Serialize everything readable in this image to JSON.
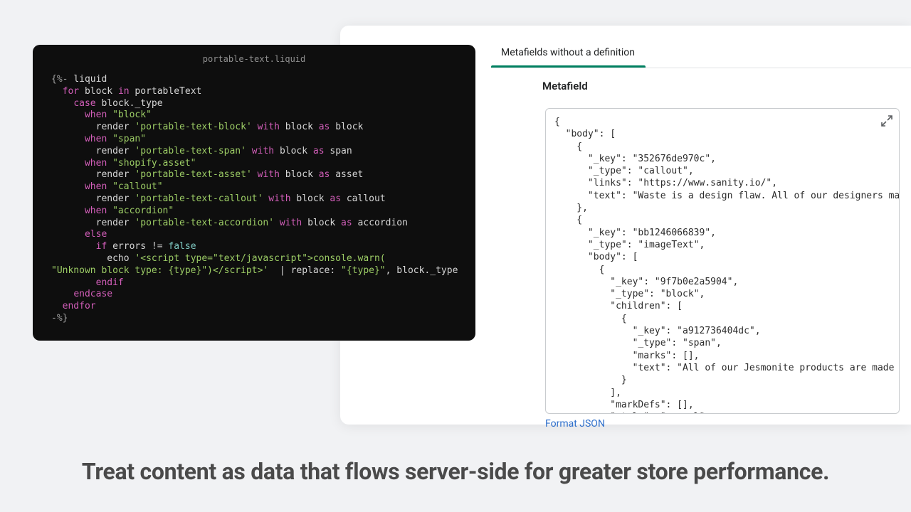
{
  "code_panel": {
    "filename": "portable-text.liquid",
    "tokens": [
      [
        [
          "punc",
          "{%- "
        ],
        [
          "ident",
          "liquid"
        ]
      ],
      [
        [
          "sp",
          "  "
        ],
        [
          "key",
          "for"
        ],
        [
          "sp",
          " "
        ],
        [
          "ident",
          "block"
        ],
        [
          "sp",
          " "
        ],
        [
          "key",
          "in"
        ],
        [
          "sp",
          " "
        ],
        [
          "ident",
          "portableText"
        ]
      ],
      [
        [
          "sp",
          "    "
        ],
        [
          "key",
          "case"
        ],
        [
          "sp",
          " "
        ],
        [
          "ident",
          "block._type"
        ]
      ],
      [
        [
          "sp",
          "      "
        ],
        [
          "key",
          "when"
        ],
        [
          "sp",
          " "
        ],
        [
          "str",
          "\"block\""
        ]
      ],
      [
        [
          "sp",
          "        "
        ],
        [
          "ident",
          "render"
        ],
        [
          "sp",
          " "
        ],
        [
          "str",
          "'portable-text-block'"
        ],
        [
          "sp",
          " "
        ],
        [
          "key",
          "with"
        ],
        [
          "sp",
          " "
        ],
        [
          "ident",
          "block"
        ],
        [
          "sp",
          " "
        ],
        [
          "key",
          "as"
        ],
        [
          "sp",
          " "
        ],
        [
          "ident",
          "block"
        ]
      ],
      [
        [
          "sp",
          "      "
        ],
        [
          "key",
          "when"
        ],
        [
          "sp",
          " "
        ],
        [
          "str",
          "\"span\""
        ]
      ],
      [
        [
          "sp",
          "        "
        ],
        [
          "ident",
          "render"
        ],
        [
          "sp",
          " "
        ],
        [
          "str",
          "'portable-text-span'"
        ],
        [
          "sp",
          " "
        ],
        [
          "key",
          "with"
        ],
        [
          "sp",
          " "
        ],
        [
          "ident",
          "block"
        ],
        [
          "sp",
          " "
        ],
        [
          "key",
          "as"
        ],
        [
          "sp",
          " "
        ],
        [
          "ident",
          "span"
        ]
      ],
      [
        [
          "sp",
          "      "
        ],
        [
          "key",
          "when"
        ],
        [
          "sp",
          " "
        ],
        [
          "str",
          "\"shopify.asset\""
        ]
      ],
      [
        [
          "sp",
          "        "
        ],
        [
          "ident",
          "render"
        ],
        [
          "sp",
          " "
        ],
        [
          "str",
          "'portable-text-asset'"
        ],
        [
          "sp",
          " "
        ],
        [
          "key",
          "with"
        ],
        [
          "sp",
          " "
        ],
        [
          "ident",
          "block"
        ],
        [
          "sp",
          " "
        ],
        [
          "key",
          "as"
        ],
        [
          "sp",
          " "
        ],
        [
          "ident",
          "asset"
        ]
      ],
      [
        [
          "sp",
          "      "
        ],
        [
          "key",
          "when"
        ],
        [
          "sp",
          " "
        ],
        [
          "str",
          "\"callout\""
        ]
      ],
      [
        [
          "sp",
          "        "
        ],
        [
          "ident",
          "render"
        ],
        [
          "sp",
          " "
        ],
        [
          "str",
          "'portable-text-callout'"
        ],
        [
          "sp",
          " "
        ],
        [
          "key",
          "with"
        ],
        [
          "sp",
          " "
        ],
        [
          "ident",
          "block"
        ],
        [
          "sp",
          " "
        ],
        [
          "key",
          "as"
        ],
        [
          "sp",
          " "
        ],
        [
          "ident",
          "callout"
        ]
      ],
      [
        [
          "sp",
          "      "
        ],
        [
          "key",
          "when"
        ],
        [
          "sp",
          " "
        ],
        [
          "str",
          "\"accordion\""
        ]
      ],
      [
        [
          "sp",
          "        "
        ],
        [
          "ident",
          "render"
        ],
        [
          "sp",
          " "
        ],
        [
          "str",
          "'portable-text-accordion'"
        ],
        [
          "sp",
          " "
        ],
        [
          "key",
          "with"
        ],
        [
          "sp",
          " "
        ],
        [
          "ident",
          "block"
        ],
        [
          "sp",
          " "
        ],
        [
          "key",
          "as"
        ],
        [
          "sp",
          " "
        ],
        [
          "ident",
          "accordion"
        ]
      ],
      [
        [
          "sp",
          "      "
        ],
        [
          "key",
          "else"
        ]
      ],
      [
        [
          "sp",
          "        "
        ],
        [
          "key",
          "if"
        ],
        [
          "sp",
          " "
        ],
        [
          "ident",
          "errors"
        ],
        [
          "sp",
          " "
        ],
        [
          "op",
          "!="
        ],
        [
          "sp",
          " "
        ],
        [
          "bool",
          "false"
        ]
      ],
      [
        [
          "sp",
          "          "
        ],
        [
          "ident",
          "echo"
        ],
        [
          "sp",
          " "
        ],
        [
          "str",
          "'<script type=\"text/javascript\">console.warn("
        ]
      ],
      [
        [
          "str",
          "\"Unknown block type: {type}\")</scr"
        ],
        [
          "str",
          "ipt>'"
        ],
        [
          "sp",
          "  "
        ],
        [
          "op",
          "|"
        ],
        [
          "sp",
          " "
        ],
        [
          "ident",
          "replace:"
        ],
        [
          "sp",
          " "
        ],
        [
          "str",
          "\"{type}\""
        ],
        [
          "op",
          ","
        ],
        [
          "sp",
          " "
        ],
        [
          "ident",
          "block._type"
        ]
      ],
      [
        [
          "sp",
          "        "
        ],
        [
          "key",
          "endif"
        ]
      ],
      [
        [
          "sp",
          "    "
        ],
        [
          "key",
          "endcase"
        ]
      ],
      [
        [
          "sp",
          "  "
        ],
        [
          "key",
          "endfor"
        ]
      ],
      [
        [
          "punc",
          "-%}"
        ]
      ]
    ]
  },
  "shopify": {
    "tab_label": "Metafields without a definition",
    "section_heading": "Metafield",
    "format_link": "Format JSON",
    "json_lines": [
      "{",
      "  \"body\": [",
      "    {",
      "      \"_key\": \"352676de970c\",",
      "      \"_type\": \"callout\",",
      "      \"links\": \"https://www.sanity.io/\",",
      "      \"text\": \"Waste is a design flaw. All of our designers make mo",
      "    },",
      "    {",
      "      \"_key\": \"bb1246066839\",",
      "      \"_type\": \"imageText\",",
      "      \"body\": [",
      "        {",
      "          \"_key\": \"9f7b0e2a5904\",",
      "          \"_type\": \"block\",",
      "          \"children\": [",
      "            {",
      "              \"_key\": \"a912736404dc\",",
      "              \"_type\": \"span\",",
      "              \"marks\": [],",
      "              \"text\": \"All of our Jesmonite products are made from",
      "            }",
      "          ],",
      "          \"markDefs\": [],",
      "          \"style\": \"normal\""
    ]
  },
  "headline": "Treat content as data that flows server-side for greater store performance."
}
